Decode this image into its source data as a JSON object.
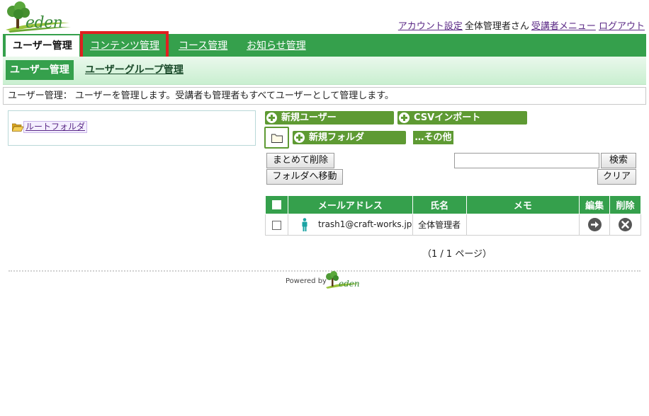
{
  "app": {
    "logo_text": "eden",
    "top_links": {
      "account_settings": "アカウント設定",
      "user_name": "全体管理者さん",
      "learner_menu": "受講者メニュー",
      "logout": "ログアウト"
    }
  },
  "main_nav": {
    "tabs": [
      {
        "label": "ユーザー管理",
        "active": true
      },
      {
        "label": "コンテンツ管理",
        "active": false,
        "highlighted": true
      },
      {
        "label": "コース管理",
        "active": false
      },
      {
        "label": "お知らせ管理",
        "active": false
      }
    ]
  },
  "sub_nav": {
    "active": "ユーザー管理",
    "link": "ユーザーグループ管理"
  },
  "description": "ユーザー管理： ユーザーを管理します。受講者も管理者もすべてユーザーとして管理します。",
  "tree": {
    "root_folder": "ルートフォルダ"
  },
  "actions": {
    "new_user": "新規ユーザー",
    "csv_import": "CSVインポート",
    "new_folder": "新規フォルダ",
    "other": "…その他",
    "bulk_delete": "まとめて削除",
    "move_to_folder": "フォルダへ移動",
    "search": "検索",
    "clear": "クリア",
    "search_value": ""
  },
  "table": {
    "headers": {
      "email": "メールアドレス",
      "name": "氏名",
      "memo": "メモ",
      "edit": "編集",
      "delete": "削除"
    },
    "rows": [
      {
        "email": "trash1@craft-works.jp",
        "name": "全体管理者",
        "memo": ""
      }
    ]
  },
  "pager": "（1 / 1 ページ）",
  "footer": {
    "powered_by": "Powered by",
    "logo_text": "eden"
  },
  "colors": {
    "brand_green": "#35a04c",
    "button_green": "#5e9a33",
    "highlight_red": "#e02020",
    "link_purple": "#5b2a86"
  }
}
